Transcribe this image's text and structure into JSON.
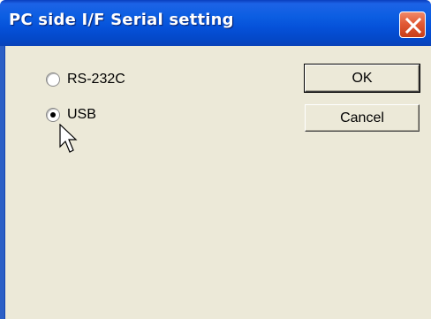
{
  "window": {
    "title": "PC side I/F  Serial setting",
    "close_icon": "close-icon"
  },
  "radios": [
    {
      "label": "RS-232C",
      "selected": false
    },
    {
      "label": "USB",
      "selected": true
    }
  ],
  "buttons": {
    "ok_label": "OK",
    "cancel_label": "Cancel"
  },
  "pointer": "arrow-cursor-icon",
  "colors": {
    "titlebar": "#0551d9",
    "client": "#ece9d8",
    "close_button": "#e25a35"
  }
}
